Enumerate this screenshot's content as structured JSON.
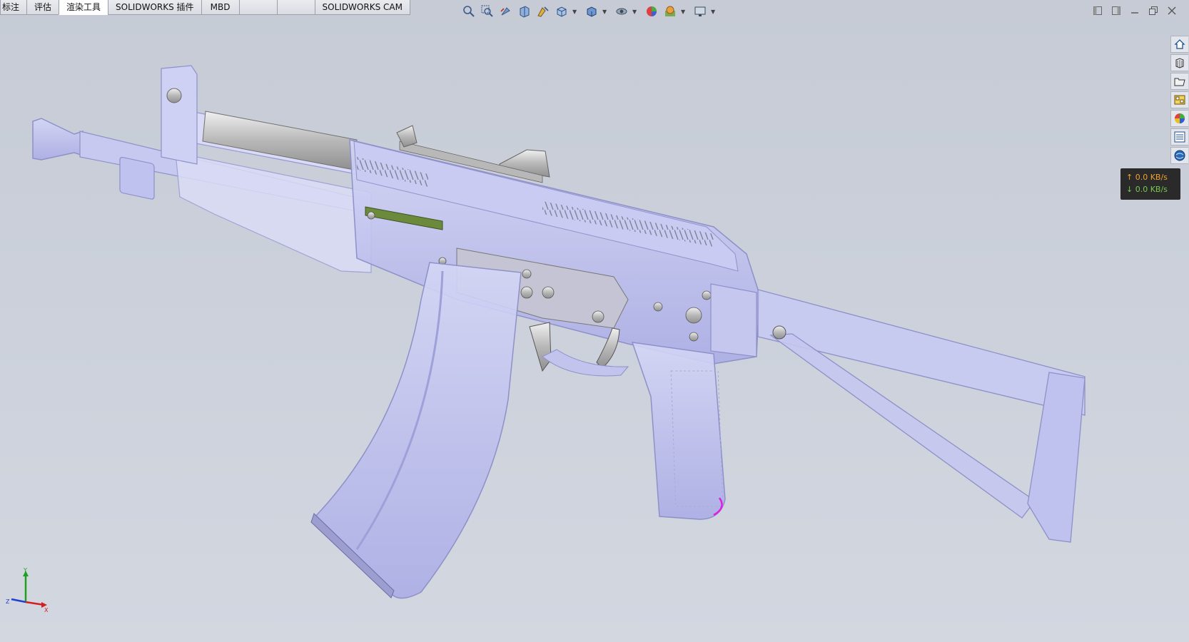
{
  "tabs": [
    {
      "label": "标注",
      "active": false
    },
    {
      "label": "评估",
      "active": false
    },
    {
      "label": "渲染工具",
      "active": true
    },
    {
      "label": "SOLIDWORKS 插件",
      "active": false
    },
    {
      "label": "MBD",
      "active": false
    },
    {
      "label": "",
      "active": false
    },
    {
      "label": "",
      "active": false
    },
    {
      "label": "SOLIDWORKS CAM",
      "active": false
    }
  ],
  "view_toolbar": [
    {
      "icon": "zoom-to-fit-icon"
    },
    {
      "icon": "zoom-to-area-icon"
    },
    {
      "icon": "previous-view-icon"
    },
    {
      "icon": "section-view-icon"
    },
    {
      "icon": "dynamic-annotation-views-icon"
    },
    {
      "icon": "view-orientation-icon"
    },
    {
      "icon": "display-style-icon"
    },
    {
      "icon": "hide-show-items-icon"
    },
    {
      "icon": "edit-appearance-icon"
    },
    {
      "icon": "apply-scene-icon"
    },
    {
      "icon": "view-settings-icon"
    }
  ],
  "window_controls": [
    {
      "icon": "tile-left-icon"
    },
    {
      "icon": "tile-right-icon"
    },
    {
      "icon": "minimize-icon"
    },
    {
      "icon": "restore-icon"
    },
    {
      "icon": "close-icon"
    }
  ],
  "task_pane": [
    {
      "icon": "solidworks-resources-icon"
    },
    {
      "icon": "design-library-icon"
    },
    {
      "icon": "file-explorer-icon"
    },
    {
      "icon": "view-palette-icon"
    },
    {
      "icon": "appearances-scenes-icon"
    },
    {
      "icon": "custom-properties-icon"
    },
    {
      "icon": "solidworks-forum-icon"
    }
  ],
  "network": {
    "upload": "↑ 0.0 KB/s",
    "download": "↓ 0.0 KB/s"
  },
  "triad": {
    "x": "X",
    "y": "Y",
    "z": "Z"
  },
  "colors": {
    "part_transparent": "#b6b8ee",
    "part_edge": "#8e90c8",
    "metal": "#c4c4c4",
    "accent_magenta": "#e020e0",
    "axis_x": "#d02020",
    "axis_y": "#20a020",
    "axis_z": "#2040d0"
  }
}
